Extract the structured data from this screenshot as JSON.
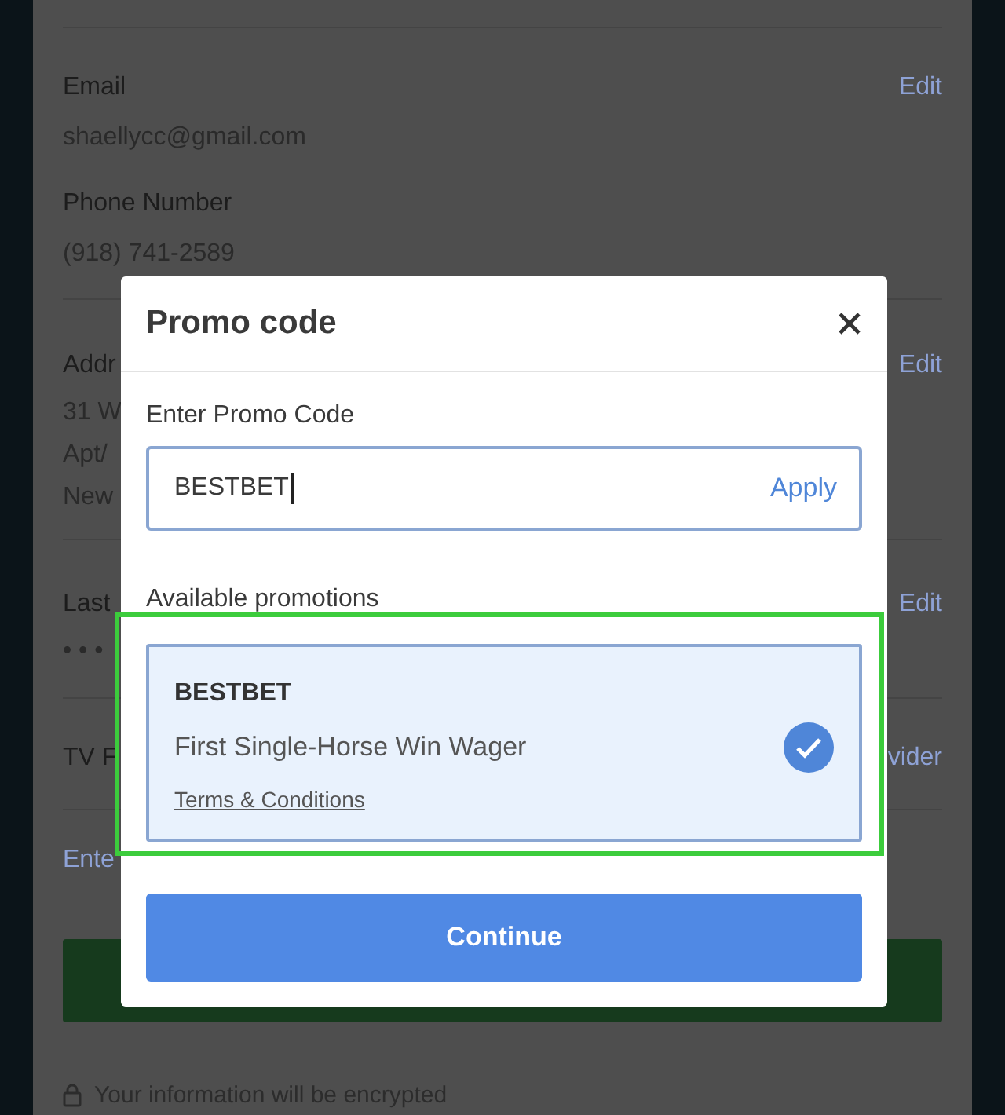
{
  "background": {
    "sections": [
      {
        "fields": [
          {
            "label": "Email",
            "value": "shaellycc@gmail.com",
            "action": "Edit"
          },
          {
            "label": "Phone Number",
            "value": "(918) 741-2589"
          }
        ]
      },
      {
        "fields": [
          {
            "label": "Addr",
            "lines": [
              "31 W",
              "Apt/",
              "New"
            ],
            "action": "Edit"
          }
        ]
      },
      {
        "fields": [
          {
            "label": "Last",
            "lines": [
              "• • •"
            ],
            "action": "Edit"
          }
        ]
      },
      {
        "fields": [
          {
            "label": "TV F",
            "action": "vider"
          }
        ]
      }
    ],
    "link": "Ente",
    "footer": "Your information will be encrypted"
  },
  "modal": {
    "title": "Promo code",
    "input_label": "Enter Promo Code",
    "input_value": "BESTBET",
    "apply": "Apply",
    "section_title": "Available promotions",
    "promotions": [
      {
        "code": "BESTBET",
        "description": "First Single-Horse Win Wager",
        "terms": "Terms & Conditions",
        "selected": true
      }
    ],
    "continue": "Continue"
  }
}
